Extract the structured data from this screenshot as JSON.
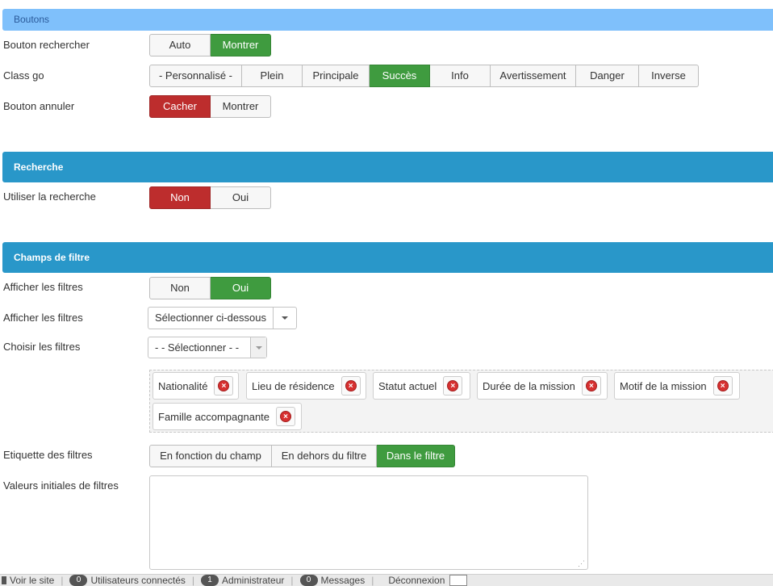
{
  "sections": {
    "boutons": "Boutons",
    "recherche": "Recherche",
    "champs": "Champs de filtre"
  },
  "fields": {
    "bouton_rechercher": {
      "label": "Bouton rechercher",
      "options": [
        "Auto",
        "Montrer"
      ],
      "selected": "Montrer"
    },
    "class_go": {
      "label": "Class go",
      "options": [
        "- Personnalisé -",
        "Plein",
        "Principale",
        "Succès",
        "Info",
        "Avertissement",
        "Danger",
        "Inverse"
      ],
      "selected": "Succès"
    },
    "bouton_annuler": {
      "label": "Bouton annuler",
      "options": [
        "Cacher",
        "Montrer"
      ],
      "selected": "Cacher"
    },
    "utiliser_recherche": {
      "label": "Utiliser la recherche",
      "options": [
        "Non",
        "Oui"
      ],
      "selected": "Non"
    },
    "afficher_filtres_toggle": {
      "label": "Afficher les filtres",
      "options": [
        "Non",
        "Oui"
      ],
      "selected": "Oui"
    },
    "afficher_filtres_select": {
      "label": "Afficher les filtres",
      "value": "Sélectionner ci-dessous"
    },
    "choisir_filtres": {
      "label": "Choisir les filtres",
      "value": "-  - Sélectionner -  -"
    },
    "filters": [
      "Nationalité",
      "Lieu de résidence",
      "Statut actuel",
      "Durée de la mission",
      "Motif de la mission",
      "Famille accompagnante"
    ],
    "etiquette_filtres": {
      "label": "Etiquette des filtres",
      "options": [
        "En fonction du champ",
        "En dehors du filtre",
        "Dans le filtre"
      ],
      "selected": "Dans le filtre"
    },
    "valeurs_initiales": {
      "label": "Valeurs initiales de filtres",
      "value": ""
    }
  },
  "colors": {
    "success": "#3f9b3f",
    "danger": "#bd2d2d",
    "section_dark": "#2997c9",
    "section_light": "#7fc0fb"
  },
  "statusbar": {
    "site_label": "Voir le site",
    "users_count": "0",
    "users_label": "Utilisateurs connectés",
    "admins_count": "1",
    "admins_label": "Administrateur",
    "messages_count": "0",
    "messages_label": "Messages",
    "logout_label": "Déconnexion"
  }
}
